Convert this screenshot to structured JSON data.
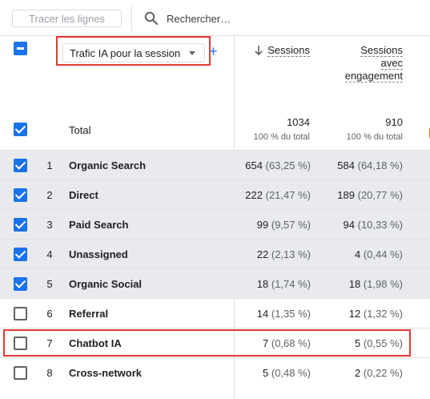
{
  "toolbar": {
    "trace_rows_label": "Tracer les lignes",
    "search_placeholder": "Rechercher…"
  },
  "header": {
    "dimension_label": "Trafic IA pour la session",
    "add_symbol": "+",
    "metric1": "Sessions",
    "metric2_line1": "Sessions",
    "metric2_line2": "avec",
    "metric2_line3": "engagement"
  },
  "total": {
    "label": "Total",
    "sessions": "1034",
    "sessions_sub": "100 % du total",
    "engaged": "910",
    "engaged_sub": "100 % du total"
  },
  "rows": [
    {
      "index": "1",
      "name": "Organic Search",
      "sessions": "654",
      "sessions_pct": "(63,25 %)",
      "engaged": "584",
      "engaged_pct": "(64,18 %)",
      "checked": true
    },
    {
      "index": "2",
      "name": "Direct",
      "sessions": "222",
      "sessions_pct": "(21,47 %)",
      "engaged": "189",
      "engaged_pct": "(20,77 %)",
      "checked": true
    },
    {
      "index": "3",
      "name": "Paid Search",
      "sessions": "99",
      "sessions_pct": "(9,57 %)",
      "engaged": "94",
      "engaged_pct": "(10,33 %)",
      "checked": true
    },
    {
      "index": "4",
      "name": "Unassigned",
      "sessions": "22",
      "sessions_pct": "(2,13 %)",
      "engaged": "4",
      "engaged_pct": "(0,44 %)",
      "checked": true
    },
    {
      "index": "5",
      "name": "Organic Social",
      "sessions": "18",
      "sessions_pct": "(1,74 %)",
      "engaged": "18",
      "engaged_pct": "(1,98 %)",
      "checked": true
    },
    {
      "index": "6",
      "name": "Referral",
      "sessions": "14",
      "sessions_pct": "(1,35 %)",
      "engaged": "12",
      "engaged_pct": "(1,32 %)",
      "checked": false
    },
    {
      "index": "7",
      "name": "Chatbot IA",
      "sessions": "7",
      "sessions_pct": "(0,68 %)",
      "engaged": "5",
      "engaged_pct": "(0,55 %)",
      "checked": false
    },
    {
      "index": "8",
      "name": "Cross-network",
      "sessions": "5",
      "sessions_pct": "(0,48 %)",
      "engaged": "2",
      "engaged_pct": "(0,22 %)",
      "checked": false
    }
  ],
  "colors": {
    "accent": "#1a73e8",
    "highlight": "#e53935"
  }
}
